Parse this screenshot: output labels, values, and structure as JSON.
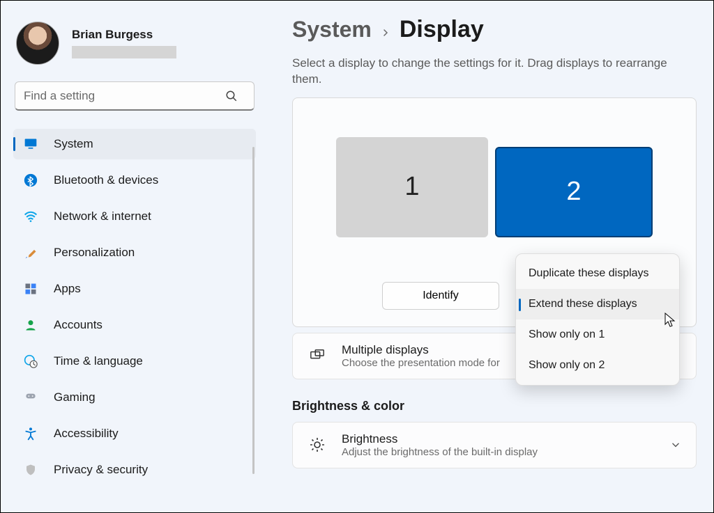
{
  "user": {
    "name": "Brian Burgess"
  },
  "search": {
    "placeholder": "Find a setting"
  },
  "nav": {
    "items": [
      {
        "label": "System",
        "icon": "monitor-icon",
        "active": true
      },
      {
        "label": "Bluetooth & devices",
        "icon": "bluetooth-icon",
        "active": false
      },
      {
        "label": "Network & internet",
        "icon": "wifi-icon",
        "active": false
      },
      {
        "label": "Personalization",
        "icon": "paintbrush-icon",
        "active": false
      },
      {
        "label": "Apps",
        "icon": "apps-icon",
        "active": false
      },
      {
        "label": "Accounts",
        "icon": "person-icon",
        "active": false
      },
      {
        "label": "Time & language",
        "icon": "clock-globe-icon",
        "active": false
      },
      {
        "label": "Gaming",
        "icon": "gamepad-icon",
        "active": false
      },
      {
        "label": "Accessibility",
        "icon": "accessibility-icon",
        "active": false
      },
      {
        "label": "Privacy & security",
        "icon": "shield-icon",
        "active": false
      }
    ]
  },
  "breadcrumb": {
    "parent": "System",
    "current": "Display"
  },
  "display": {
    "helper": "Select a display to change the settings for it. Drag displays to rearrange them.",
    "monitors": [
      {
        "label": "1",
        "selected": false
      },
      {
        "label": "2",
        "selected": true
      }
    ],
    "identify_label": "Identify",
    "mode_options": [
      {
        "label": "Duplicate these displays",
        "selected": false
      },
      {
        "label": "Extend these displays",
        "selected": true
      },
      {
        "label": "Show only on 1",
        "selected": false
      },
      {
        "label": "Show only on 2",
        "selected": false
      }
    ],
    "multiple": {
      "title": "Multiple displays",
      "subtitle": "Choose the presentation mode for"
    },
    "section_brightness_heading": "Brightness & color",
    "brightness": {
      "title": "Brightness",
      "subtitle": "Adjust the brightness of the built-in display"
    }
  },
  "colors": {
    "accent": "#0067c0"
  }
}
